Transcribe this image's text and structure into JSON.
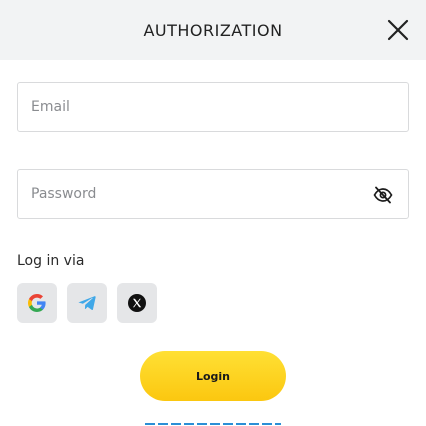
{
  "header": {
    "title": "AUTHORIZATION",
    "close_icon": "close-icon"
  },
  "form": {
    "email": {
      "value": "",
      "placeholder": "Email"
    },
    "password": {
      "value": "",
      "placeholder": "Password",
      "toggle_icon": "eye-off-icon"
    }
  },
  "social": {
    "label": "Log in via",
    "providers": [
      {
        "name": "Google",
        "icon": "google-icon"
      },
      {
        "name": "Telegram",
        "icon": "telegram-icon",
        "color": "#40a8e8"
      },
      {
        "name": "X",
        "icon": "x-icon"
      }
    ]
  },
  "actions": {
    "login_label": "Login",
    "login_color": "#fcd71c",
    "link_color": "#2b8fd6"
  }
}
